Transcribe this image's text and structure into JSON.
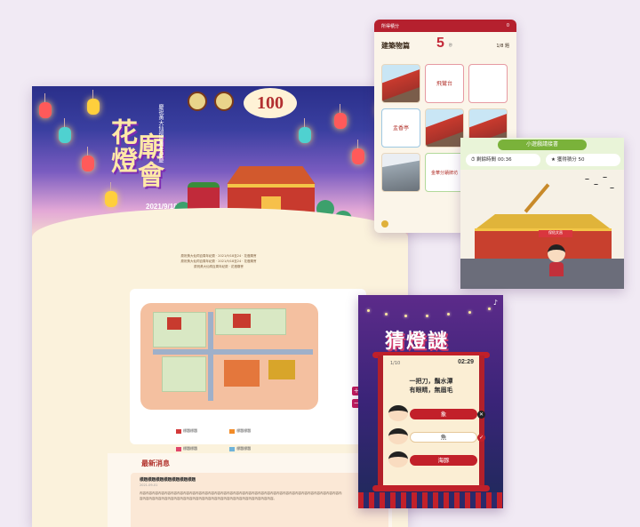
{
  "main_site": {
    "festival_title_1": "花燈",
    "festival_title_2": "廟會",
    "festival_subtitle": "慶祝黃大仙祠百周年紀慶",
    "festival_date": "2021/9/18至24",
    "logo_badge": "100",
    "news_section_title": "最新消息",
    "news_item_title": "標題標題標題標題標題標題標題",
    "news_item_meta": "2021-09-01",
    "map_zoom_in": "+",
    "map_zoom_out": "−",
    "legend": [
      {
        "label": "標題標題",
        "color": "#d33a3a"
      },
      {
        "label": "標題標題",
        "color": "#f28c28"
      },
      {
        "label": "標題標題",
        "color": "#e0456a"
      },
      {
        "label": "標題標題",
        "color": "#6fb3d9"
      },
      {
        "label": "標題標題",
        "color": "#8cc152"
      },
      {
        "label": "標題標題",
        "color": "#f0c23a"
      }
    ]
  },
  "quiz_card": {
    "score_label": "所得積分",
    "score_value": "0",
    "category": "建築物篇",
    "countdown": "5",
    "countdown_unit": "秒",
    "progress": "1/8 題",
    "tiles": [
      "",
      "飛鸞台",
      "",
      "盂香亭",
      "",
      "",
      "",
      "金華分蹟牌坊",
      ""
    ]
  },
  "game_card": {
    "title": "小遊戲請接書",
    "remaining_label": "剩餘時間",
    "remaining_value": "00:36",
    "score_label": "獲得積分",
    "score_value": "50",
    "banner": "保佑文昌"
  },
  "riddle_card": {
    "title": "猜燈謎",
    "index": "1/10",
    "timer": "02:29",
    "question_line1": "一把刀，鬚水潭",
    "question_line2": "有眼睛，無眉毛",
    "options": [
      "象",
      "魚",
      "海豚"
    ],
    "music_icon": "music-note-icon"
  },
  "colors": {
    "accent_red": "#b5202e",
    "night_blue": "#2a2f8a",
    "paper": "#fbf2dc",
    "purple": "#5c2b8a"
  }
}
